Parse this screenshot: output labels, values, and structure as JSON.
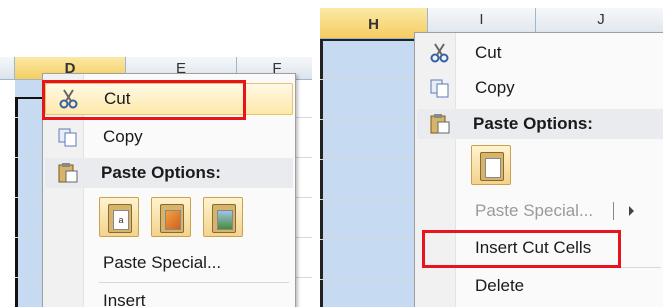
{
  "left": {
    "columns": [
      {
        "label": "D"
      },
      {
        "label": "E"
      },
      {
        "label": "F"
      }
    ],
    "menu": {
      "cut_label": "Cut",
      "copy_label": "Copy",
      "paste_options_label": "Paste Options:",
      "paste_special_label": "Paste Special...",
      "insert_label": "Insert"
    }
  },
  "right": {
    "columns": [
      {
        "label": "H"
      },
      {
        "label": "I"
      },
      {
        "label": "J"
      }
    ],
    "menu": {
      "cut_label": "Cut",
      "copy_label": "Copy",
      "paste_options_label": "Paste Options:",
      "paste_special_label": "Paste Special...",
      "insert_cut_cells_label": "Insert Cut Cells",
      "delete_label": "Delete"
    }
  },
  "colors": {
    "highlight_box": "#e8141c",
    "selection": "#c6daf1"
  }
}
